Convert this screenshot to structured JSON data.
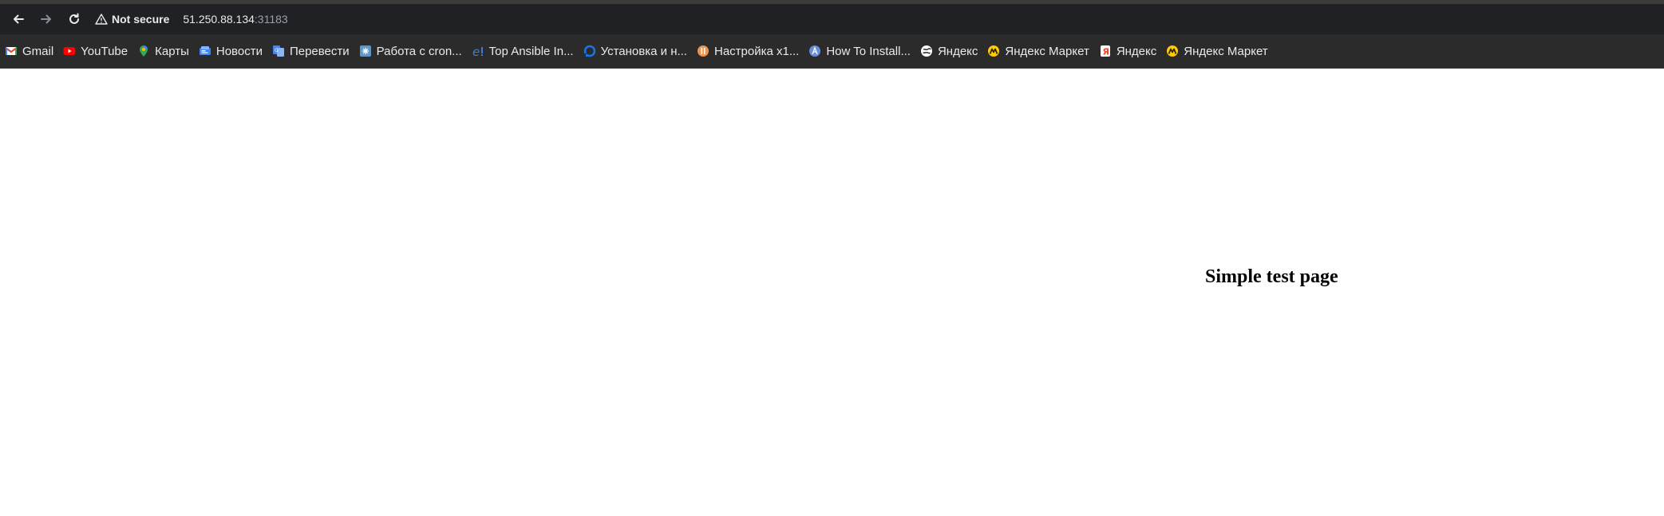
{
  "browser": {
    "not_secure_label": "Not secure",
    "url_host": "51.250.88.134",
    "url_port": ":31183"
  },
  "bookmarks": [
    {
      "label": "Gmail",
      "icon": "gmail-icon"
    },
    {
      "label": "YouTube",
      "icon": "youtube-icon"
    },
    {
      "label": "Карты",
      "icon": "maps-icon"
    },
    {
      "label": "Новости",
      "icon": "news-icon"
    },
    {
      "label": "Перевести",
      "icon": "translate-icon"
    },
    {
      "label": "Работа с cron...",
      "icon": "cron-icon"
    },
    {
      "label": "Top Ansible In...",
      "icon": "ansible-icon"
    },
    {
      "label": "Установка и н...",
      "icon": "install-icon"
    },
    {
      "label": "Настройка x1...",
      "icon": "setup-icon"
    },
    {
      "label": "How To Install...",
      "icon": "howto-icon"
    },
    {
      "label": "Яндекс",
      "icon": "yandex-globe-icon"
    },
    {
      "label": "Яндекс Маркет",
      "icon": "yandex-market-icon"
    },
    {
      "label": "Яндекс",
      "icon": "yandex-icon"
    },
    {
      "label": "Яндекс Маркет",
      "icon": "yandex-market-icon"
    }
  ],
  "page": {
    "heading": "Simple test page"
  }
}
